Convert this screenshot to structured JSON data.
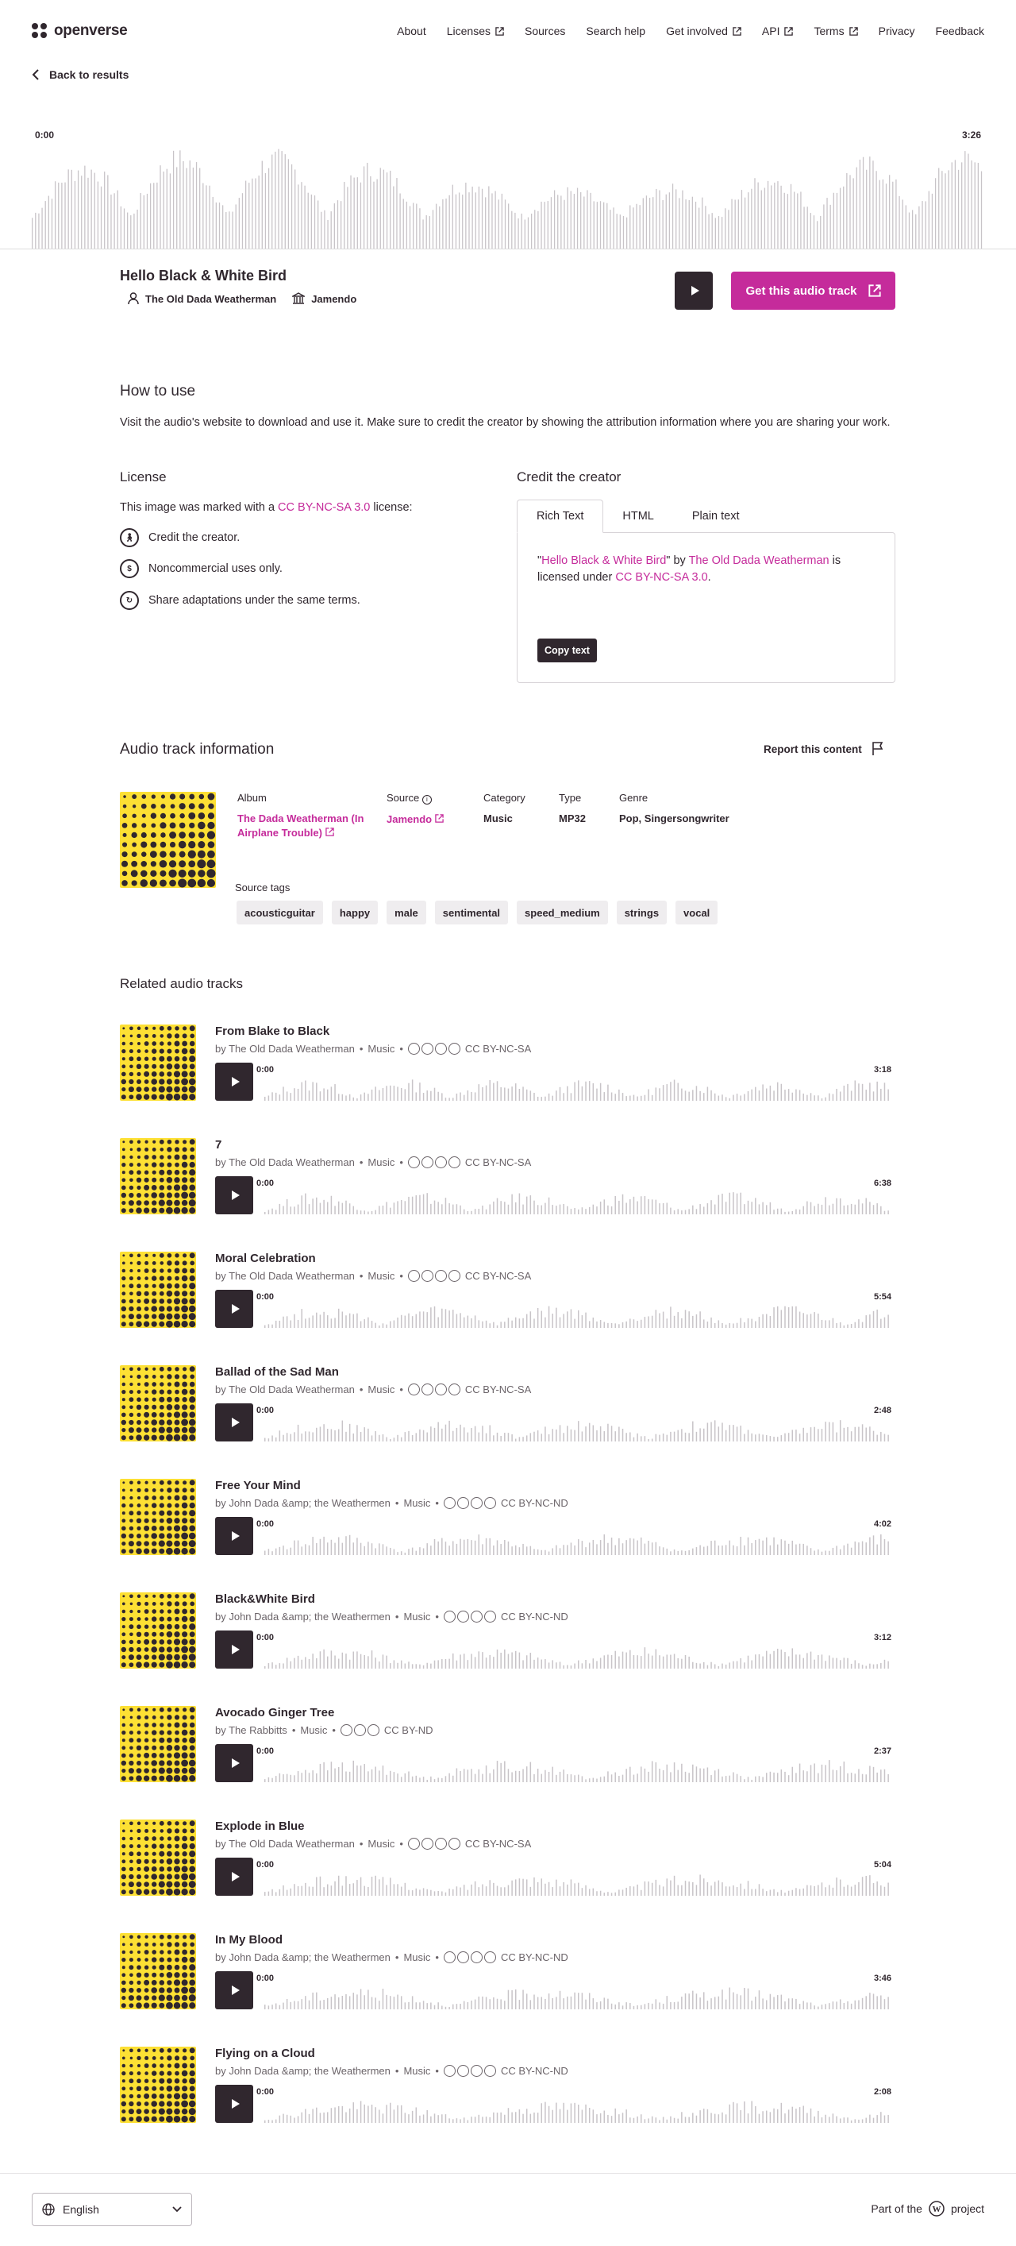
{
  "brand": {
    "name": "openverse"
  },
  "nav": {
    "items": [
      "About",
      "Licenses",
      "Sources",
      "Search help",
      "Get involved",
      "API",
      "Terms",
      "Privacy",
      "Feedback"
    ]
  },
  "back": {
    "label": "Back to results"
  },
  "player": {
    "time_start": "0:00",
    "time_end": "3:26"
  },
  "track": {
    "title": "Hello Black & White Bird",
    "creator": "The Old Dada Weatherman",
    "source": "Jamendo",
    "get_label": "Get this audio track"
  },
  "how_to_use": {
    "heading": "How to use",
    "text": "Visit the audio's website to download and use it. Make sure to credit the creator by showing the attribution information where you are sharing your work."
  },
  "license": {
    "heading": "License",
    "intro_pre": "This image was marked with a ",
    "intro_link": "CC BY-NC-SA 3.0",
    "intro_post": " license:",
    "items": [
      "Credit the creator.",
      "Noncommercial uses only.",
      "Share adaptations under the same terms."
    ]
  },
  "credit": {
    "heading": "Credit the creator",
    "tabs": [
      "Rich Text",
      "HTML",
      "Plain text"
    ],
    "q1": "\"",
    "title_link": "Hello Black & White Bird",
    "q2": "\" by ",
    "creator_link": "The Old Dada Weatherman",
    "mid": " is licensed under ",
    "license_link": "CC BY-NC-SA 3.0",
    "end": ".",
    "copy_label": "Copy text"
  },
  "info": {
    "heading": "Audio track information",
    "report_label": "Report this content",
    "album_label": "Album",
    "album_value": "The Dada Weatherman (In Airplane Trouble)",
    "source_label": "Source",
    "source_value": "Jamendo",
    "category_label": "Category",
    "category_value": "Music",
    "type_label": "Type",
    "type_value": "MP32",
    "genre_label": "Genre",
    "genre_value": "Pop, Singersongwriter",
    "tags_label": "Source tags",
    "tags": [
      "acousticguitar",
      "happy",
      "male",
      "sentimental",
      "speed_medium",
      "strings",
      "vocal"
    ]
  },
  "related": {
    "heading": "Related audio tracks",
    "items": [
      {
        "title": "From Blake to Black",
        "creator": "by The Old Dada Weatherman",
        "category": "Music",
        "license": "CC BY-NC-SA",
        "start": "0:00",
        "duration": "3:18"
      },
      {
        "title": "7",
        "creator": "by The Old Dada Weatherman",
        "category": "Music",
        "license": "CC BY-NC-SA",
        "start": "0:00",
        "duration": "6:38"
      },
      {
        "title": "Moral Celebration",
        "creator": "by The Old Dada Weatherman",
        "category": "Music",
        "license": "CC BY-NC-SA",
        "start": "0:00",
        "duration": "5:54"
      },
      {
        "title": "Ballad of the Sad Man",
        "creator": "by The Old Dada Weatherman",
        "category": "Music",
        "license": "CC BY-NC-SA",
        "start": "0:00",
        "duration": "2:48"
      },
      {
        "title": "Free Your Mind",
        "creator": "by John Dada &amp; the Weathermen",
        "category": "Music",
        "license": "CC BY-NC-ND",
        "start": "0:00",
        "duration": "4:02"
      },
      {
        "title": "Black&White Bird",
        "creator": "by John Dada &amp; the Weathermen",
        "category": "Music",
        "license": "CC BY-NC-ND",
        "start": "0:00",
        "duration": "3:12"
      },
      {
        "title": "Avocado Ginger Tree",
        "creator": "by The Rabbitts",
        "category": "Music",
        "license": "CC BY-ND",
        "start": "0:00",
        "duration": "2:37"
      },
      {
        "title": "Explode in Blue",
        "creator": "by The Old Dada Weatherman",
        "category": "Music",
        "license": "CC BY-NC-SA",
        "start": "0:00",
        "duration": "5:04"
      },
      {
        "title": "In My Blood",
        "creator": "by John Dada &amp; the Weathermen",
        "category": "Music",
        "license": "CC BY-NC-ND",
        "start": "0:00",
        "duration": "3:46"
      },
      {
        "title": "Flying on a Cloud",
        "creator": "by John Dada &amp; the Weathermen",
        "category": "Music",
        "license": "CC BY-NC-ND",
        "start": "0:00",
        "duration": "2:08"
      }
    ]
  },
  "footer": {
    "language": "English",
    "part_of_pre": "Part of the",
    "part_of_post": "project"
  },
  "colors": {
    "accent": "#c52b9b",
    "dark": "#30272e",
    "art_yellow": "#fde034"
  }
}
